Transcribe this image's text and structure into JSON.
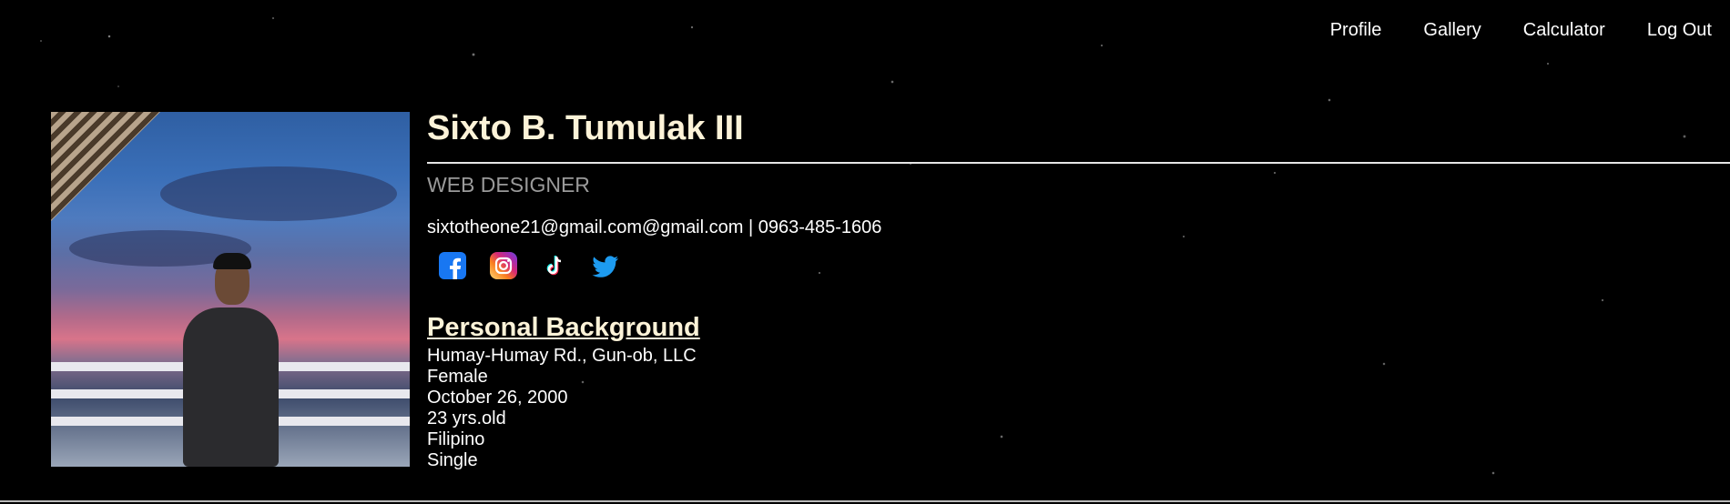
{
  "nav": {
    "items": [
      "Profile",
      "Gallery",
      "Calculator",
      "Log Out"
    ]
  },
  "profile": {
    "name": "Sixto B. Tumulak III",
    "role": "WEB DESIGNER",
    "contact": "sixtotheone21@gmail.com@gmail.com | 0963-485-1606",
    "socials": [
      "facebook-icon",
      "instagram-icon",
      "tiktok-icon",
      "twitter-icon"
    ]
  },
  "background": {
    "title": "Personal Background",
    "address": "Humay-Humay Rd., Gun-ob, LLC",
    "gender": "Female",
    "birthdate": "October 26, 2000",
    "age": "23 yrs.old",
    "nationality": "Filipino",
    "status": "Single"
  },
  "colors": {
    "page_bg": "#000000",
    "name": "#fdf3d8",
    "role": "#9a9a9a",
    "facebook": "#1877f2",
    "twitter": "#1d9bf0"
  }
}
